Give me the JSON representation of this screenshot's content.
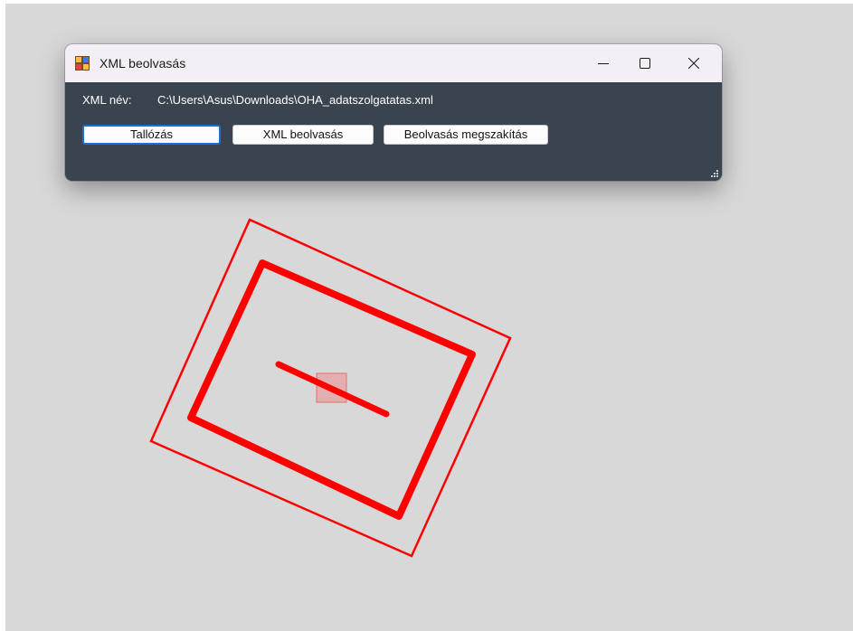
{
  "window": {
    "title": "XML beolvasás",
    "app_icon": "windows-form-icon",
    "controls": {
      "minimize_icon": "minimize-icon",
      "maximize_icon": "maximize-icon",
      "close_icon": "close-icon"
    }
  },
  "form": {
    "xml_name_label": "XML név:",
    "xml_path": "C:\\Users\\Asus\\Downloads\\OHA_adatszolgatatas.xml",
    "browse_label": "Tallózás",
    "read_label": "XML beolvasás",
    "cancel_label": "Beolvasás megszakítás",
    "resize_grip_icon": "resize-grip-icon"
  },
  "colors": {
    "canvas_background": "#d8d8d8",
    "form_background": "#3a4350",
    "titlebar_background": "#f4eff7",
    "shape_stroke": "#ff0000",
    "marker_fill": "#e8a0a0"
  }
}
